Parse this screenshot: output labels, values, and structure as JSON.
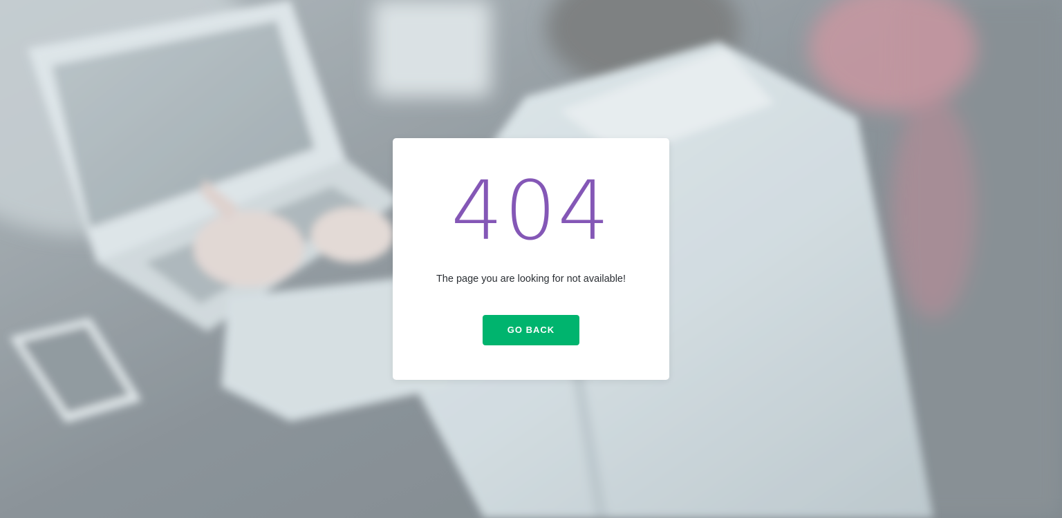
{
  "page": {
    "background_description_colors": {
      "backdrop": "#8f979c",
      "accent_purple": "#8457b6",
      "button_green": "#00b46e",
      "card_white": "#ffffff"
    }
  },
  "error_card": {
    "code": "404",
    "message": "The page you are looking for not available!",
    "button_label": "GO BACK"
  }
}
